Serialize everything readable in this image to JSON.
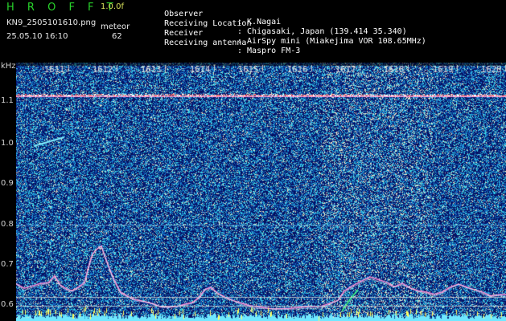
{
  "header": {
    "brand": "H R O F F T",
    "version": "1.0.0f",
    "filename": "KN9_2505101610.png",
    "datetime": "25.05.10 16:10",
    "meteor_label": "meteor",
    "meteor_count": "62",
    "info": [
      {
        "label": "Observer",
        "value": ": K.Nagai"
      },
      {
        "label": "Receiving Location",
        "value": ": Chigasaki, Japan (139.414 35.340)"
      },
      {
        "label": "Receiver",
        "value": ": AirSpy mini (Miakejima VOR 108.65MHz)"
      },
      {
        "label": "Receiving antenna",
        "value": ": Maspro FM-3"
      }
    ]
  },
  "axis": {
    "y_unit": "kHz",
    "y_ticks": [
      "1.1",
      "1.0",
      "0.9",
      "0.8",
      "0.7",
      "0.6"
    ],
    "x_ticks": [
      "1611",
      "1612",
      "1613",
      "1614",
      "1615",
      "1616",
      "1617",
      "1618",
      "1619",
      "1620"
    ]
  },
  "colors": {
    "background": "#000000",
    "waterfall_low": "#081a78",
    "waterfall_mid": "#2a58d8",
    "carrier": "#ff6a6a",
    "trace": "#ff8fd8",
    "baseline": "#5fe0ff"
  }
}
